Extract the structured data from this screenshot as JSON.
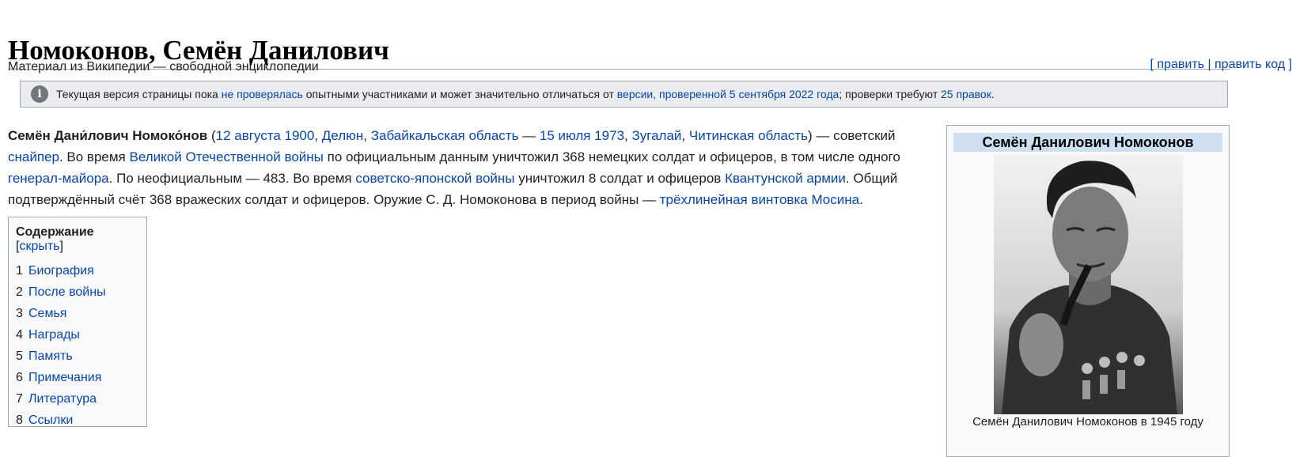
{
  "page": {
    "title": "Номоконов, Семён Данилович",
    "subtitle": "Материал из Википедии — свободной энциклопедии",
    "edit": {
      "open": "[",
      "edit_label": "править",
      "sep": "|",
      "edit_code_label": "править код",
      "close": "]"
    }
  },
  "notice": {
    "icon": "info-icon",
    "t1": "Текущая версия страницы пока ",
    "l1": "не проверялась",
    "t2": " опытными участниками и может значительно отличаться от ",
    "l2": "версии, проверенной 5 сентября 2022 года",
    "t3": "; проверки требуют ",
    "l3": "25 правок",
    "t4": "."
  },
  "lead": {
    "name": "Семён Дани́лович Номоко́нов",
    "p1": " (",
    "birth_date": "12 августа 1900",
    "c1": ", ",
    "birth_place": "Делюн",
    "c2": ", ",
    "birth_region": "Забайкальская область",
    "dash": " — ",
    "death_date": "15 июля 1973",
    "c3": ", ",
    "death_place": "Зугалай",
    "c4": ", ",
    "death_region": "Читинская область",
    "t1": ") — советский ",
    "l_sniper": "снайпер",
    "t2": ". Во время ",
    "l_war": "Великой Отечественной войны",
    "t3": " по официальным данным уничтожил 368 немецких солдат и офицеров, в том числе одного ",
    "l_general": "генерал-майора",
    "t4": ". По неофициальным — 483. Во время ",
    "l_sovjap": "советско-японской войны",
    "t5": " уничтожил 8 солдат и офицеров ",
    "l_kwantung": "Квантунской армии",
    "t6": ". Общий подтверждённый счёт 368 вражеских солдат и офицеров. Оружие С. Д. Номоконова в период войны — ",
    "l_rifle": "трёхлинейная винтовка Мосина",
    "t7": "."
  },
  "toc": {
    "title": "Содержание",
    "hide_open": " [",
    "hide_label": "скрыть",
    "hide_close": "]",
    "items": [
      {
        "num": "1",
        "label": "Биография"
      },
      {
        "num": "2",
        "label": "После войны"
      },
      {
        "num": "3",
        "label": "Семья"
      },
      {
        "num": "4",
        "label": "Награды"
      },
      {
        "num": "5",
        "label": "Память"
      },
      {
        "num": "6",
        "label": "Примечания"
      },
      {
        "num": "7",
        "label": "Литература"
      },
      {
        "num": "8",
        "label": "Ссылки"
      }
    ]
  },
  "infobox": {
    "title": "Семён Данилович Номоконов",
    "caption": "Семён Данилович Номоконов в 1945 году"
  },
  "colors": {
    "link": "#0645ad",
    "text": "#202122",
    "notice_bg": "#eaecf0",
    "infobox_header": "#cedff2",
    "border": "#a2a9b1"
  }
}
